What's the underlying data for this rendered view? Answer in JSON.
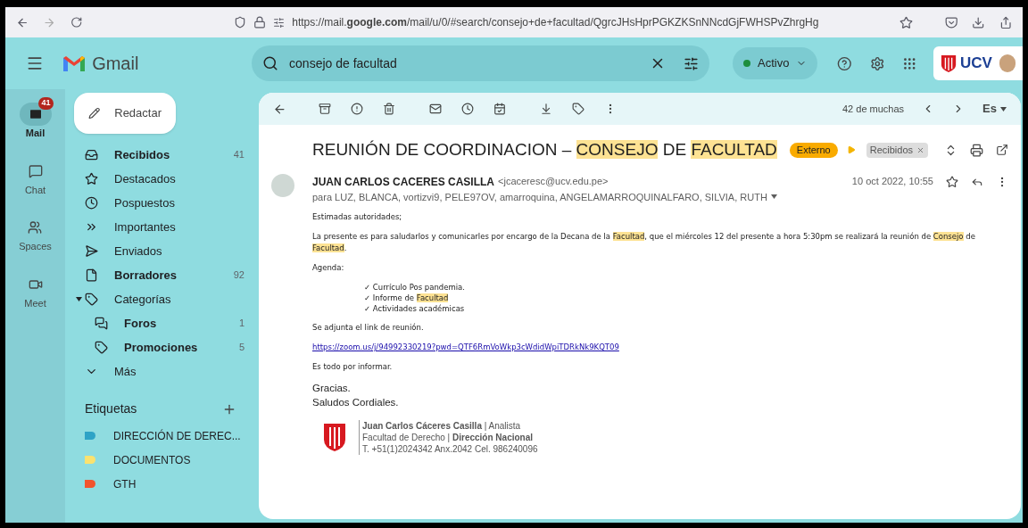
{
  "browser": {
    "url": "https://mail.**google.com**/mail/u/0/#search/consejo+de+facultad/QgrcJHsHprPGKZKSnNNcdGjFWHSPvZhrgHg"
  },
  "header": {
    "app_name": "Gmail",
    "search": {
      "value": "consejo de facultad"
    },
    "status": "Activo",
    "org_logo": "UCV"
  },
  "rail": [
    {
      "label": "Mail",
      "selected": true,
      "badge": "41",
      "kind": "mail"
    },
    {
      "label": "Chat",
      "selected": false,
      "kind": "chat"
    },
    {
      "label": "Spaces",
      "selected": false,
      "kind": "spaces"
    },
    {
      "label": "Meet",
      "selected": false,
      "kind": "meet"
    }
  ],
  "compose": "Redactar",
  "folders": [
    {
      "label": "Recibidos",
      "count": "41",
      "bold": true,
      "kind": "inbox"
    },
    {
      "label": "Destacados",
      "bold": false,
      "kind": "star"
    },
    {
      "label": "Pospuestos",
      "bold": false,
      "kind": "clock"
    },
    {
      "label": "Importantes",
      "bold": false,
      "kind": "important"
    },
    {
      "label": "Enviados",
      "bold": false,
      "kind": "send"
    },
    {
      "label": "Borradores",
      "count": "92",
      "bold": true,
      "kind": "draft"
    },
    {
      "label": "Categorías",
      "bold": false,
      "kind": "category",
      "expanded": true,
      "children": [
        {
          "label": "Foros",
          "count": "1",
          "bold": true,
          "kind": "forum"
        },
        {
          "label": "Promociones",
          "count": "5",
          "bold": true,
          "kind": "tag"
        }
      ]
    },
    {
      "label": "Más",
      "bold": false,
      "kind": "more"
    }
  ],
  "labels": {
    "title": "Etiquetas",
    "items": [
      {
        "name": "DIRECCIÓN DE DEREC...",
        "color": "#2ea3c6"
      },
      {
        "name": "DOCUMENTOS",
        "color": "#fbe26f"
      },
      {
        "name": "GTH",
        "color": "#f2542d"
      }
    ]
  },
  "toolbar": {
    "count": "42 de muchas",
    "language": "Es"
  },
  "message": {
    "subject": [
      {
        "text": "REUNIÓN DE COORDINACION – ",
        "highlight": false
      },
      {
        "text": "CONSEJO",
        "highlight": true
      },
      {
        "text": " DE ",
        "highlight": false
      },
      {
        "text": "FACULTAD",
        "highlight": true
      }
    ],
    "tags": [
      {
        "label": "Externo",
        "kind": "external"
      },
      {
        "label": "Recibidos",
        "kind": "folder"
      }
    ],
    "sender": "JUAN CARLOS CACERES CASILLA",
    "email": "<jcaceresc@ucv.edu.pe>",
    "date": "10 oct 2022, 10:55",
    "to": "para LUZ, BLANCA, vortizvi9, PELE97OV, amarroquina, ANGELAMARROQUINALFARO, SILVIA, RUTH",
    "body": [
      {
        "kind": "p",
        "segments": [
          {
            "text": "Estimadas autoridades;",
            "highlight": false
          }
        ]
      },
      {
        "kind": "p",
        "segments": [
          {
            "text": "La presente es para saludarlos y comunicarles por encargo de la Decana de la ",
            "highlight": false
          },
          {
            "text": "Facultad",
            "highlight": true
          },
          {
            "text": ", que el miércoles 12 del presente a hora 5:30pm se realizará la reunión de ",
            "highlight": false
          },
          {
            "text": "Consejo",
            "highlight": true
          },
          {
            "text": " de ",
            "highlight": false
          },
          {
            "text": "Facultad",
            "highlight": true
          },
          {
            "text": ".",
            "highlight": false
          }
        ]
      },
      {
        "kind": "p",
        "segments": [
          {
            "text": "Agenda:",
            "highlight": false
          }
        ]
      },
      {
        "kind": "list",
        "items": [
          [
            {
              "text": "✓ Currículo Pos pandemia.",
              "highlight": false
            }
          ],
          [
            {
              "text": "✓ Informe de ",
              "highlight": false
            },
            {
              "text": "Facultad",
              "highlight": true
            }
          ],
          [
            {
              "text": "✓ Actividades académicas",
              "highlight": false
            }
          ]
        ]
      },
      {
        "kind": "p",
        "segments": [
          {
            "text": "Se adjunta el link de reunión.",
            "highlight": false
          }
        ]
      },
      {
        "kind": "link",
        "text": "https://zoom.us/j/94992330219?pwd=QTF6RmVoWkp3cWdidWpiTDRkNk9KQT09"
      },
      {
        "kind": "p",
        "segments": [
          {
            "text": "Es todo por informar.",
            "highlight": false
          }
        ]
      },
      {
        "kind": "lines",
        "lines": [
          "Gracias.",
          "Saludos Cordiales."
        ]
      }
    ],
    "signature": [
      "**Juan Carlos Cáceres Casilla** | Analista",
      "Facultad de Derecho | **Dirección Nacional**",
      "T. +51(1)2024342 Anx.2042   Cel. 986240096"
    ]
  }
}
